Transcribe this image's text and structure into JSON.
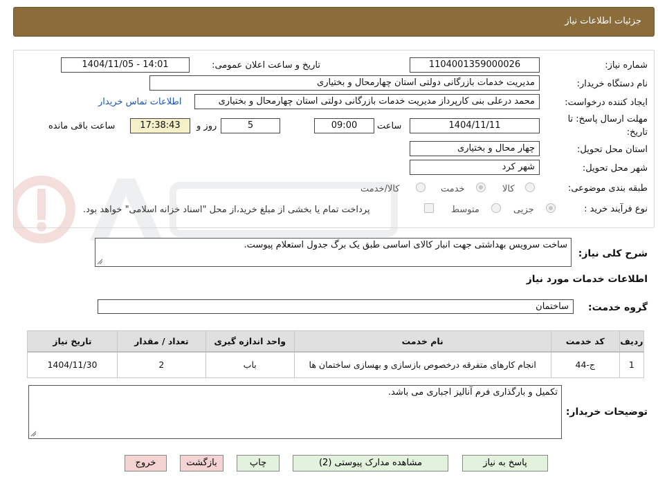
{
  "header": {
    "title": "جزئیات اطلاعات نیاز"
  },
  "form": {
    "need_number_label": "شماره نیاز:",
    "need_number": "1104001359000026",
    "announce_label": "تاریخ و ساعت اعلان عمومی:",
    "announce_value": "1404/11/05 - 14:01",
    "buyer_org_label": "نام دستگاه خریدار:",
    "buyer_org": "مدیریت خدمات بازرگانی دولتی استان چهارمحال و بختیاری",
    "creator_label": "ایجاد کننده درخواست:",
    "creator": "محمد درعلی بنی کارپرداز مدیریت خدمات بازرگانی دولتی استان چهارمحال و بختیاری",
    "contact_link": "اطلاعات تماس خریدار",
    "deadline_label_1": "مهلت ارسال پاسخ: تا",
    "deadline_label_2": "تاریخ:",
    "deadline_date": "1404/11/11",
    "time_label": "ساعت",
    "deadline_time": "09:00",
    "days_value": "5",
    "days_label": "روز و",
    "remaining_time": "17:38:43",
    "remaining_label": "ساعت باقی مانده",
    "province_label": "استان محل تحویل:",
    "province": "چهار محال و بختیاری",
    "city_label": "شهر محل تحویل:",
    "city": "شهر کرد",
    "category_label": "طبقه بندی موضوعی:",
    "category_options": [
      "کالا",
      "خدمت",
      "کالا/خدمت"
    ],
    "process_label": "نوع فرآیند خرید :",
    "process_options": [
      "جزیی",
      "متوسط"
    ],
    "treasury_note": "پرداخت تمام یا بخشی از مبلغ خرید،از محل \"اسناد خزانه اسلامی\" خواهد بود."
  },
  "description": {
    "label": "شرح کلی نیاز:",
    "text": "ساخت سرویس بهداشتی جهت انبار کالای اساسی طبق یک برگ جدول استعلام پیوست."
  },
  "services": {
    "section_title": "اطلاعات خدمات مورد نیاز",
    "group_label": "گروه خدمت:",
    "group_value": "ساختمان",
    "columns": [
      "ردیف",
      "کد خدمت",
      "نام خدمت",
      "واحد اندازه گیری",
      "تعداد / مقدار",
      "تاریخ نیاز"
    ],
    "rows": [
      [
        "1",
        "ج-44",
        "انجام کارهای متفرقه درخصوص بازسازی و بهسازی ساختمان ها",
        "باب",
        "2",
        "1404/11/30"
      ]
    ]
  },
  "buyer_notes": {
    "label": "توضیحات خریدار:",
    "text": "تکمیل و بارگذاری فرم آنالیز اجباری می باشد."
  },
  "buttons": {
    "reply": "پاسخ به نیاز",
    "attachments": "مشاهده مدارک پیوستی (2)",
    "print": "چاپ",
    "back": "بازگشت",
    "exit": "خروج"
  },
  "colors": {
    "header_bg": "#8a6d3b",
    "link": "#1a55c0",
    "green_button": "#e2f2dc",
    "pink_button": "#f6d3d3"
  }
}
